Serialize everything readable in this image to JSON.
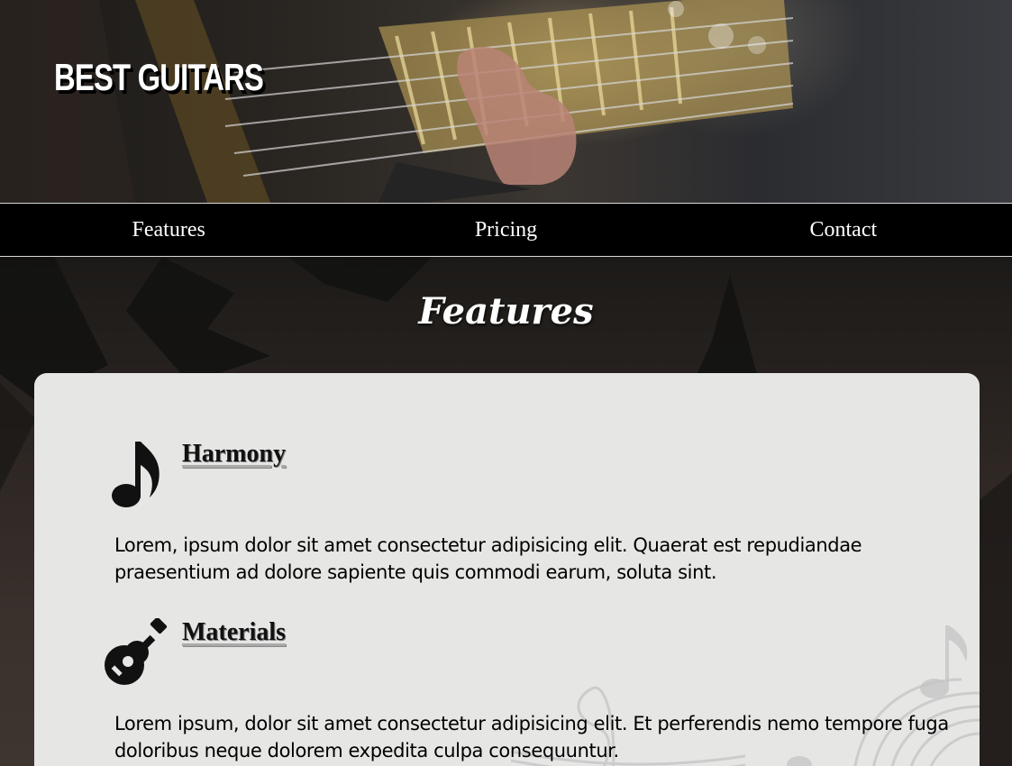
{
  "header": {
    "brand": "BEST GUITARS"
  },
  "nav": {
    "items": [
      {
        "label": "Features"
      },
      {
        "label": "Pricing"
      },
      {
        "label": "Contact"
      }
    ]
  },
  "features": {
    "title": "Features",
    "items": [
      {
        "icon": "music-note-icon",
        "title": "Harmony",
        "text": "Lorem, ipsum dolor sit amet consectetur adipisicing elit. Quaerat est repudiandae praesentium ad dolore sapiente quis commodi earum, soluta sint."
      },
      {
        "icon": "guitar-icon",
        "title": "Materials",
        "text": "Lorem ipsum, dolor sit amet consectetur adipisicing elit. Et perferendis nemo tempore fuga doloribus neque dolorem expedita culpa consequuntur."
      }
    ]
  }
}
